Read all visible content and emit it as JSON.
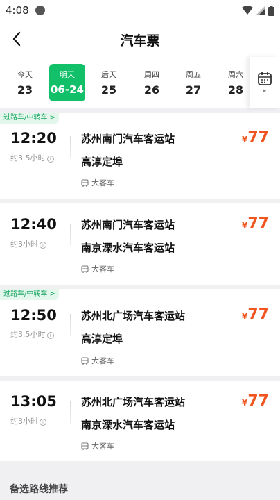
{
  "status": {
    "time": "4:08"
  },
  "header": {
    "title": "汽车票"
  },
  "dates": [
    {
      "label": "今天",
      "num": "23",
      "active": false
    },
    {
      "label": "明天",
      "num": "06-24",
      "active": true
    },
    {
      "label": "后天",
      "num": "25",
      "active": false
    },
    {
      "label": "周四",
      "num": "26",
      "active": false
    },
    {
      "label": "周五",
      "num": "27",
      "active": false
    },
    {
      "label": "周六",
      "num": "28",
      "active": false
    }
  ],
  "trips": [
    {
      "tag": "过路车/中转车 >",
      "time": "12:20",
      "duration": "约3.5小时",
      "from": "苏州南门汽车客运站",
      "to": "高淳定埠",
      "bus": "大客车",
      "currency": "¥",
      "price": "77"
    },
    {
      "tag": "",
      "time": "12:40",
      "duration": "约3小时",
      "from": "苏州南门汽车客运站",
      "to": "南京溧水汽车客运站",
      "bus": "大客车",
      "currency": "¥",
      "price": "77"
    },
    {
      "tag": "过路车/中转车 >",
      "time": "12:50",
      "duration": "约3.5小时",
      "from": "苏州北广场汽车客运站",
      "to": "高淳定埠",
      "bus": "大客车",
      "currency": "¥",
      "price": "77"
    },
    {
      "tag": "",
      "time": "13:05",
      "duration": "约3小时",
      "from": "苏州北广场汽车客运站",
      "to": "南京溧水汽车客运站",
      "bus": "大客车",
      "currency": "¥",
      "price": "77"
    }
  ],
  "recommend": {
    "title": "备选路线推荐"
  },
  "colors": {
    "accent": "#12c06a",
    "price": "#f0541f",
    "tag_text": "#12a35e"
  }
}
